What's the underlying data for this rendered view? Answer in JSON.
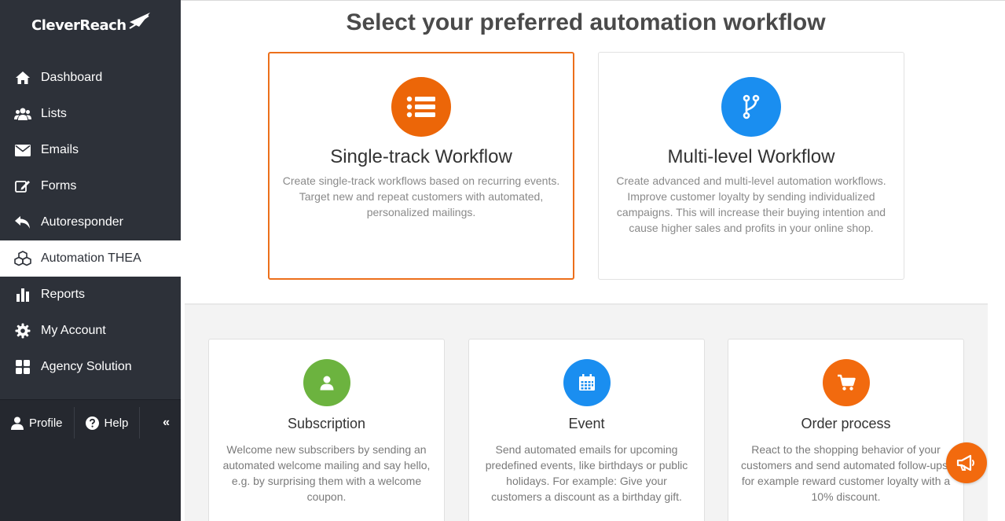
{
  "app": {
    "logo_text": "CleverReach"
  },
  "sidebar": {
    "items": [
      {
        "label": "Dashboard",
        "icon": "home-icon"
      },
      {
        "label": "Lists",
        "icon": "users-icon"
      },
      {
        "label": "Emails",
        "icon": "envelope-icon"
      },
      {
        "label": "Forms",
        "icon": "edit-icon"
      },
      {
        "label": "Autoresponder",
        "icon": "reply-icon"
      },
      {
        "label": "Automation THEA",
        "icon": "cubes-icon",
        "active": true
      },
      {
        "label": "Reports",
        "icon": "bar-chart-icon"
      },
      {
        "label": "My Account",
        "icon": "gear-icon"
      },
      {
        "label": "Agency Solution",
        "icon": "grid-icon"
      }
    ],
    "footer": {
      "profile": "Profile",
      "help": "Help",
      "collapse": "«"
    }
  },
  "main": {
    "title": "Select your preferred automation workflow",
    "workflows": [
      {
        "title": "Single-track Workflow",
        "description": "Create single-track workflows based on recurring events. Target new and repeat customers with automated, personalized mailings.",
        "icon": "list-icon",
        "color": "#ec6608",
        "selected": true
      },
      {
        "title": "Multi-level Workflow",
        "description": "Create advanced and multi-level automation workflows. Improve customer loyalty by sending individualized campaigns. This will increase their buying intention and cause higher sales and profits in your online shop.",
        "icon": "branch-icon",
        "color": "#1a8ef0",
        "selected": false
      }
    ],
    "templates": [
      {
        "title": "Subscription",
        "description": "Welcome new subscribers by sending an automated welcome mailing and say hello, e.g. by surprising them with a welcome coupon.",
        "icon": "user-icon",
        "color": "#6cb33f"
      },
      {
        "title": "Event",
        "description": "Send automated emails for upcoming predefined events, like birthdays or public holidays. For example: Give your customers a discount as a birthday gift.",
        "icon": "calendar-icon",
        "color": "#1a8ef0"
      },
      {
        "title": "Order process",
        "description": "React to the shopping behavior of your customers and send automated follow-ups, for example reward customer loyalty with a 10% discount.",
        "icon": "cart-icon",
        "color": "#f26a0e"
      }
    ],
    "fab_icon": "megaphone-icon"
  }
}
